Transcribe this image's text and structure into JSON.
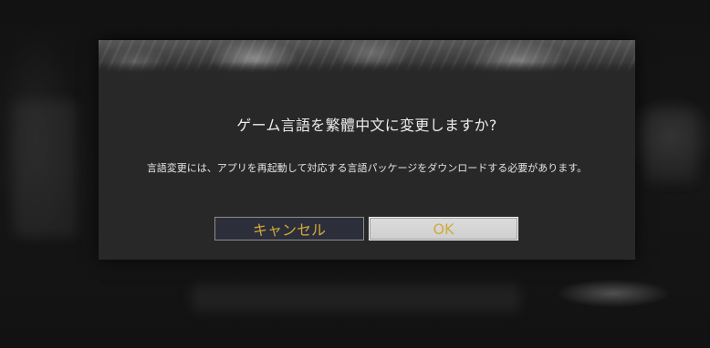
{
  "dialog": {
    "title": "ゲーム言語を繁體中文に変更しますか?",
    "message": "言語変更には、アプリを再起動して対応する言語パッケージをダウンロードする必要があります。",
    "buttons": {
      "cancel_label": "キャンセル",
      "ok_label": "OK"
    }
  },
  "colors": {
    "button_text": "#d2a93c",
    "dialog_background": "#282828",
    "cancel_button_background": "#2c2f3a",
    "ok_button_background": "#d6d6d6"
  }
}
